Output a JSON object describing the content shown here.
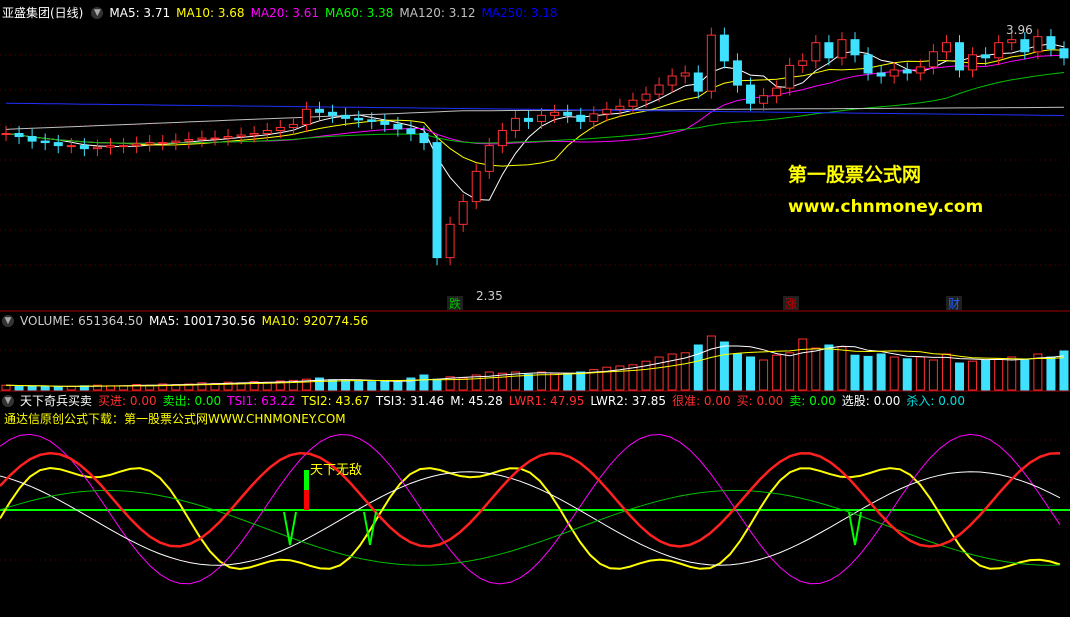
{
  "price_panel": {
    "stock_name": "亚盛集团(日线)",
    "ma": [
      {
        "label": "MA5: 3.71",
        "color": "#ffffff"
      },
      {
        "label": "MA10: 3.68",
        "color": "#ffff00"
      },
      {
        "label": "MA20: 3.61",
        "color": "#ff00ff"
      },
      {
        "label": "MA60: 3.38",
        "color": "#00ff00"
      },
      {
        "label": "MA120: 3.12",
        "color": "#c0c0c0"
      },
      {
        "label": "MA250: 3.18",
        "color": "#0000ff"
      }
    ],
    "high_label": "3.96",
    "low_label": "2.35",
    "markers": [
      {
        "text": "跌",
        "color": "#00c000"
      },
      {
        "text": "涨",
        "color": "#c00000"
      },
      {
        "text": "财",
        "color": "#2060ff"
      }
    ],
    "watermark_cn": "第一股票公式网",
    "watermark_url": "www.chnmoney.com"
  },
  "volume_panel": {
    "items": [
      {
        "label": "VOLUME: 651364.50",
        "color": "#cccccc"
      },
      {
        "label": "MA5: 1001730.56",
        "color": "#ffffff"
      },
      {
        "label": "MA10: 920774.56",
        "color": "#ffff00"
      }
    ]
  },
  "indicator_panel": {
    "title": "天下奇兵买卖",
    "items": [
      {
        "label": "买进: 0.00",
        "color": "#ff3030"
      },
      {
        "label": "卖出: 0.00",
        "color": "#00ff00"
      },
      {
        "label": "TSI1: 63.22",
        "color": "#ff00ff"
      },
      {
        "label": "TSI2: 43.67",
        "color": "#ffff00"
      },
      {
        "label": "TSI3: 31.46",
        "color": "#ffffff"
      },
      {
        "label": "M: 45.28",
        "color": "#ffffff"
      },
      {
        "label": "LWR1: 47.95",
        "color": "#ff3030"
      },
      {
        "label": "LWR2: 37.85",
        "color": "#ffffff"
      },
      {
        "label": "很准: 0.00",
        "color": "#ff3030"
      },
      {
        "label": "买: 0.00",
        "color": "#ff3030"
      },
      {
        "label": "卖: 0.00",
        "color": "#00ff00"
      },
      {
        "label": "选股: 0.00",
        "color": "#ffffff"
      },
      {
        "label": "杀入: 0.00",
        "color": "#00e0e0"
      }
    ],
    "promo": "通达信原创公式下载：第一股票公式网WWW.CHNMONEY.COM",
    "signal_text": "天下无敌"
  },
  "chart_data": {
    "type": "candlestick",
    "price_ylim": [
      2.2,
      4.05
    ],
    "candles": [
      3.3,
      3.28,
      3.25,
      3.24,
      3.22,
      3.22,
      3.2,
      3.21,
      3.22,
      3.22,
      3.23,
      3.24,
      3.24,
      3.25,
      3.26,
      3.27,
      3.27,
      3.28,
      3.29,
      3.3,
      3.32,
      3.34,
      3.36,
      3.46,
      3.44,
      3.42,
      3.4,
      3.39,
      3.38,
      3.36,
      3.33,
      3.3,
      3.24,
      2.48,
      2.7,
      2.85,
      3.05,
      3.22,
      3.32,
      3.4,
      3.38,
      3.42,
      3.44,
      3.42,
      3.38,
      3.43,
      3.46,
      3.48,
      3.52,
      3.56,
      3.62,
      3.68,
      3.7,
      3.58,
      3.95,
      3.78,
      3.62,
      3.5,
      3.55,
      3.6,
      3.75,
      3.78,
      3.9,
      3.8,
      3.92,
      3.82,
      3.7,
      3.68,
      3.72,
      3.7,
      3.74,
      3.84,
      3.9,
      3.72,
      3.82,
      3.8,
      3.9,
      3.92,
      3.84,
      3.94,
      3.86,
      3.8
    ],
    "volume": [
      0.08,
      0.07,
      0.06,
      0.06,
      0.05,
      0.06,
      0.07,
      0.08,
      0.07,
      0.07,
      0.09,
      0.08,
      0.1,
      0.09,
      0.1,
      0.12,
      0.11,
      0.13,
      0.12,
      0.14,
      0.13,
      0.15,
      0.16,
      0.18,
      0.2,
      0.17,
      0.16,
      0.15,
      0.14,
      0.14,
      0.13,
      0.2,
      0.25,
      0.18,
      0.22,
      0.2,
      0.25,
      0.3,
      0.28,
      0.3,
      0.26,
      0.3,
      0.28,
      0.27,
      0.3,
      0.34,
      0.38,
      0.4,
      0.42,
      0.48,
      0.55,
      0.6,
      0.62,
      0.75,
      0.9,
      0.8,
      0.6,
      0.55,
      0.5,
      0.58,
      0.62,
      0.85,
      0.7,
      0.75,
      0.72,
      0.58,
      0.56,
      0.6,
      0.55,
      0.52,
      0.55,
      0.5,
      0.6,
      0.45,
      0.48,
      0.5,
      0.52,
      0.55,
      0.5,
      0.6,
      0.55,
      0.65
    ],
    "tsi_ylim": [
      0,
      100
    ]
  }
}
